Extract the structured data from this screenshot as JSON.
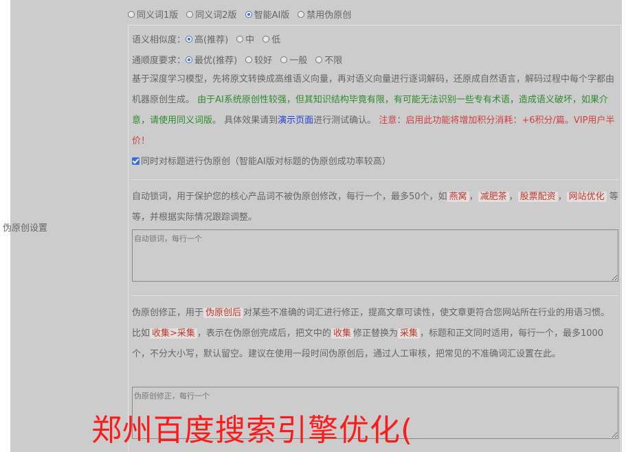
{
  "section_label": "伪原创设置",
  "versions": [
    {
      "label": "同义词1版",
      "selected": false
    },
    {
      "label": "同义词2版",
      "selected": false
    },
    {
      "label": "智能AI版",
      "selected": true
    },
    {
      "label": "禁用伪原创",
      "selected": false
    }
  ],
  "similarity": {
    "label": "语义相似度：",
    "options": [
      {
        "label": "高(推荐)",
        "selected": true
      },
      {
        "label": "中",
        "selected": false
      },
      {
        "label": "低",
        "selected": false
      }
    ]
  },
  "fluency": {
    "label": "通顺度要求：",
    "options": [
      {
        "label": "最优(推荐)",
        "selected": true
      },
      {
        "label": "较好",
        "selected": false
      },
      {
        "label": "一般",
        "selected": false
      },
      {
        "label": "不限",
        "selected": false
      }
    ]
  },
  "description": {
    "part1": "基于深度学习模型，先将原文转换成高维语义向量，再对语义向量进行逐词解码，还原成自然语言，解码过程中每个字都由机器原创生成。",
    "part2_green": " 由于AI系统原创性较强，但其知识结构毕竟有限，有可能无法识别一些专有术语，造成语义破坏，如果介意，请使用同义词版。",
    "part3": " 具体效果请到",
    "demo_link": "演示页面",
    "part4": "进行测试确认。",
    "part5_red": " 注意：启用此功能将增加积分消耗：+6积分/篇。VIP用户半价！"
  },
  "title_checkbox": {
    "label": "同时对标题进行伪原创（智能AI版对标题的伪原创成功率较高）",
    "checked": true
  },
  "lock_words": {
    "text_before": "自动锁词，用于保护您的核心产品词不被伪原创修改，每行一个，最多50个，如",
    "examples": [
      "燕窝",
      "减肥茶",
      "股票配资",
      "网站优化"
    ],
    "text_after": "等等，并根据实际情况跟踪调整。",
    "placeholder": "自动锁词，每行一个"
  },
  "correction": {
    "text1": "伪原创修正，用于",
    "tag1": "伪原创后",
    "text2": "对某些不准确的词汇进行修正，提高文章可读性，使文章更符合您网站所在行业的用语习惯。比如",
    "tag2": "收集>采集",
    "text3": "，表示在伪原创完成后，把文中的",
    "tag3": "收集",
    "text4": "修正替换为",
    "tag4": "采集",
    "text5": "，标题和正文同时适用，每行一个，最多1000个，不分大小写，默认留空。建议在使用一段时间伪原创后，通过人工审核，把常见的不准确词汇设置在此。",
    "placeholder": "伪原创修正，每行一个"
  },
  "watermark": "郑州百度搜索引擎优化("
}
